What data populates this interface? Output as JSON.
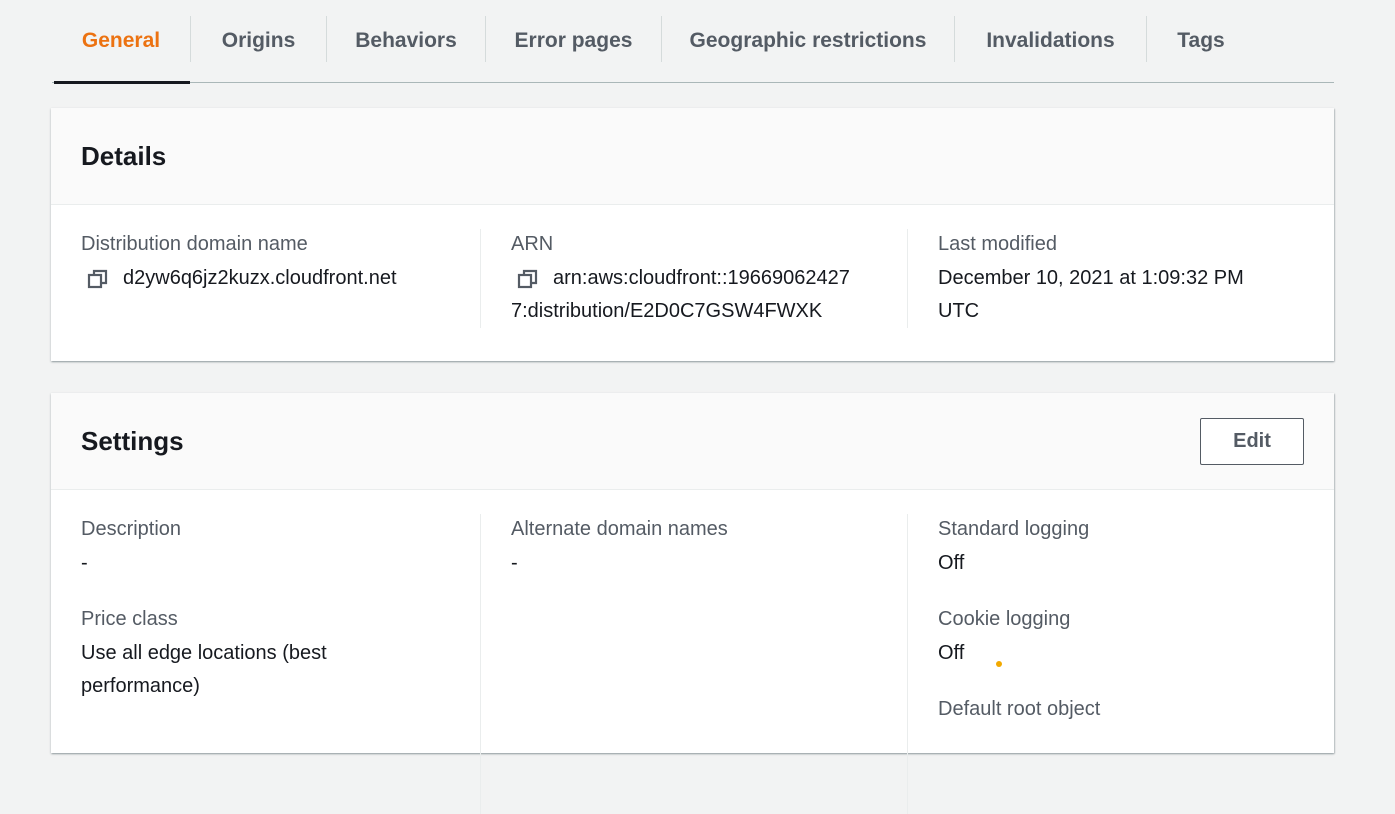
{
  "tabs": [
    {
      "label": "General",
      "active": true
    },
    {
      "label": "Origins"
    },
    {
      "label": "Behaviors"
    },
    {
      "label": "Error pages"
    },
    {
      "label": "Geographic restrictions"
    },
    {
      "label": "Invalidations"
    },
    {
      "label": "Tags"
    }
  ],
  "details": {
    "title": "Details",
    "domain_label": "Distribution domain name",
    "domain_value": "d2yw6q6jz2kuzx.cloudfront.net",
    "arn_label": "ARN",
    "arn_line1": "arn:aws:cloudfront::19669062427",
    "arn_line2": "7:distribution/E2D0C7GSW4FWXK",
    "modified_label": "Last modified",
    "modified_line1": "December 10, 2021 at 1:09:32 PM",
    "modified_line2": "UTC"
  },
  "settings": {
    "title": "Settings",
    "edit_label": "Edit",
    "description_label": "Description",
    "description_value": "-",
    "price_label": "Price class",
    "price_line1": "Use all edge locations (best",
    "price_line2": "performance)",
    "alt_label": "Alternate domain names",
    "alt_value": "-",
    "std_logging_label": "Standard logging",
    "std_logging_value": "Off",
    "cookie_label": "Cookie logging",
    "cookie_value": "Off",
    "root_label": "Default root object"
  },
  "colors": {
    "accent": "#ec7211",
    "text": "#16191f",
    "muted": "#545b64",
    "bg": "#f2f3f3"
  }
}
